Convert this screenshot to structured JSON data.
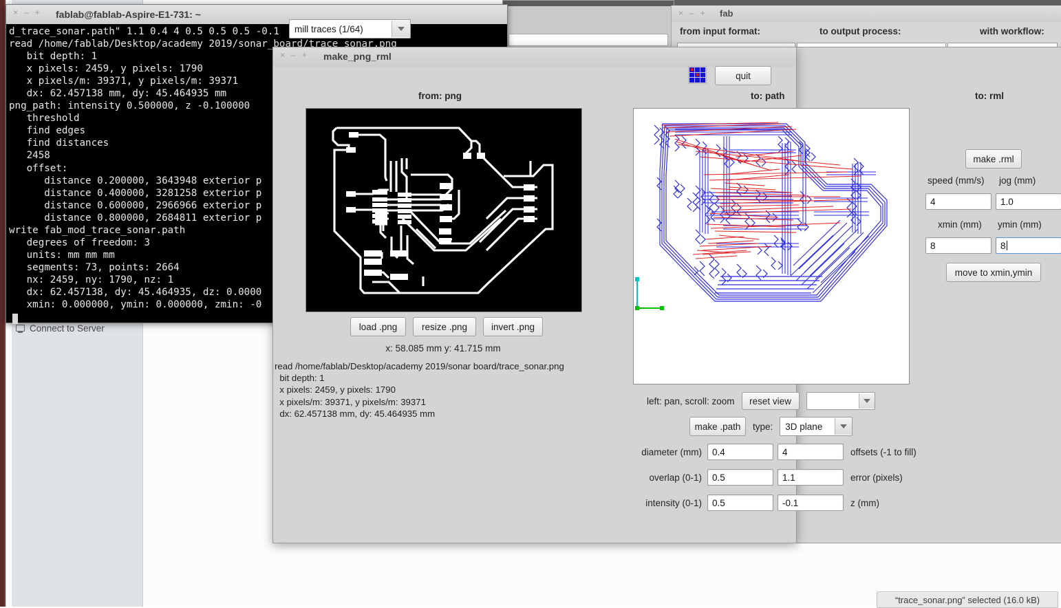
{
  "desktop": {
    "filemanager": {
      "sidebar_item": "Connect to Server",
      "sidebar_icon": "server-icon",
      "statusbar": "“trace_sonar.png” selected  (16.0 kB)"
    }
  },
  "fab_window": {
    "title": "fab",
    "window_buttons": [
      "×",
      "–",
      "+"
    ],
    "columns": [
      "from input format:",
      "to output process:",
      "with workflow:"
    ],
    "inputs": [
      "",
      "",
      ""
    ]
  },
  "terminal": {
    "title": "fablab@fablab-Aspire-E1-731: ~",
    "window_buttons": [
      "×",
      "–",
      "+"
    ],
    "output": "d_trace_sonar.path\" 1.1 0.4 4 0.5 0.5 0.5 -0.1\nread /home/fablab/Desktop/academy 2019/sonar_board/trace_sonar.png\n   bit depth: 1\n   x pixels: 2459, y pixels: 1790\n   x pixels/m: 39371, y pixels/m: 39371\n   dx: 62.457138 mm, dy: 45.464935 mm\npng_path: intensity 0.500000, z -0.100000\n   threshold\n   find edges\n   find distances\n   2458\n   offset:\n      distance 0.200000, 3643948 exterior p\n      distance 0.400000, 3281258 exterior p\n      distance 0.600000, 2966966 exterior p\n      distance 0.800000, 2684811 exterior p\nwrite fab_mod_trace_sonar.path\n   degrees of freedom: 3\n   units: mm mm mm\n   segments: 73, points: 2664\n   nx: 2459, ny: 1790, nz: 1\n   dx: 62.457138, dy: 45.464935, dz: 0.0000\n   xmin: 0.000000, ymin: 0.000000, zmin: -0"
  },
  "mod_window": {
    "title": "make_png_rml",
    "window_buttons": [
      "×",
      "–",
      "+"
    ],
    "toolbar": {
      "process_select": "mill traces (1/64)",
      "logo_icon": "fab-modules-logo-icon",
      "quit_label": "quit"
    },
    "headers": {
      "from": "from: png",
      "to_path": "to: path",
      "to_rml": "to: rml"
    },
    "png_panel": {
      "buttons": [
        "load .png",
        "resize .png",
        "invert .png"
      ],
      "coords": "x: 58.085 mm  y: 41.715 mm",
      "info": "read /home/fablab/Desktop/academy 2019/sonar board/trace_sonar.png\n  bit depth: 1\n  x pixels: 2459, y pixels: 1790\n  x pixels/m: 39371, y pixels/m: 39371\n  dx: 62.457138 mm, dy: 45.464935 mm"
    },
    "path_panel": {
      "pan_hint": "left: pan, scroll: zoom",
      "reset_label": "reset view",
      "view_select": "",
      "make_path_label": "make .path",
      "type_label": "type:",
      "type_select": "3D plane",
      "params": [
        {
          "left_label": "diameter (mm)",
          "left_value": "0.4",
          "right_value": "4",
          "right_label": "offsets (-1 to fill)"
        },
        {
          "left_label": "overlap (0-1)",
          "left_value": "0.5",
          "right_value": "1.1",
          "right_label": "error (pixels)"
        },
        {
          "left_label": "intensity (0-1)",
          "left_value": "0.5",
          "right_value": "-0.1",
          "right_label": "z (mm)"
        }
      ]
    },
    "rml_panel": {
      "make_rml_label": "make .rml",
      "speed_label": "speed (mm/s)",
      "speed_value": "4",
      "jog_label": "jog (mm)",
      "jog_value": "1.0",
      "xmin_label": "xmin (mm)",
      "xmin_value": "8",
      "ymin_label": "ymin (mm)",
      "ymin_value": "8",
      "move_label": "move to xmin,ymin"
    }
  },
  "colors": {
    "toolpath_cut": "#1818e0",
    "toolpath_jog": "#e01010",
    "axis_x": "#00c000",
    "axis_y": "#00c8c8",
    "png_trace": "#ffffff",
    "png_background": "#000000",
    "window_chrome": "#d4d4d4",
    "launcher": "#5d2a2a"
  }
}
